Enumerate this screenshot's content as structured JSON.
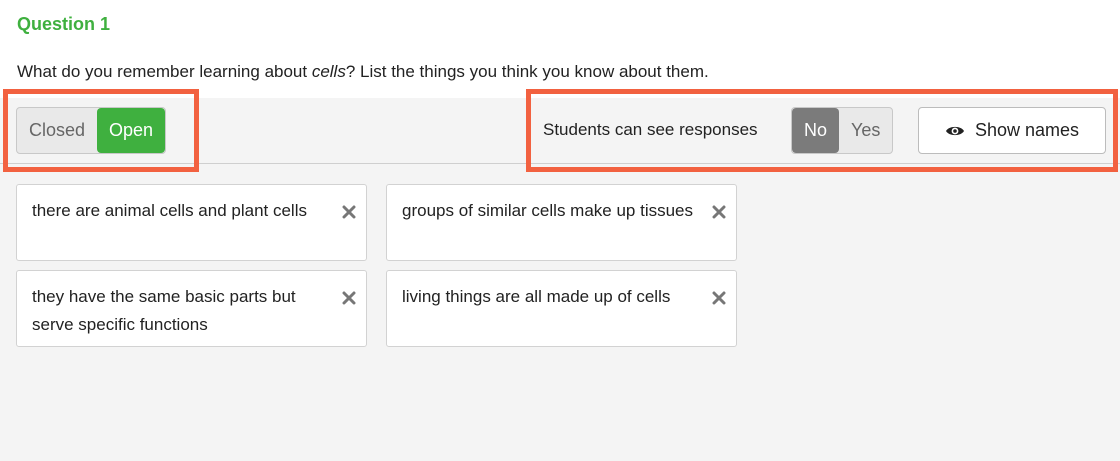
{
  "question": {
    "title": "Question 1",
    "prompt_before": "What do you remember learning about ",
    "prompt_em": "cells",
    "prompt_after": "? List the things you think you know about them."
  },
  "status_toggle": {
    "options": [
      "Closed",
      "Open"
    ],
    "selected": "Open",
    "active_color": "#3fb03f"
  },
  "responses_visibility": {
    "label": "Students can see responses",
    "options": [
      "No",
      "Yes"
    ],
    "selected": "No"
  },
  "show_names": {
    "label": "Show names",
    "icon": "eye-icon"
  },
  "responses": [
    "there are animal cells and plant cells",
    "groups of similar cells make up tissues",
    "they have the same basic parts but serve specific functions",
    "living things are all made up of cells"
  ],
  "highlight_color": "#f26140"
}
